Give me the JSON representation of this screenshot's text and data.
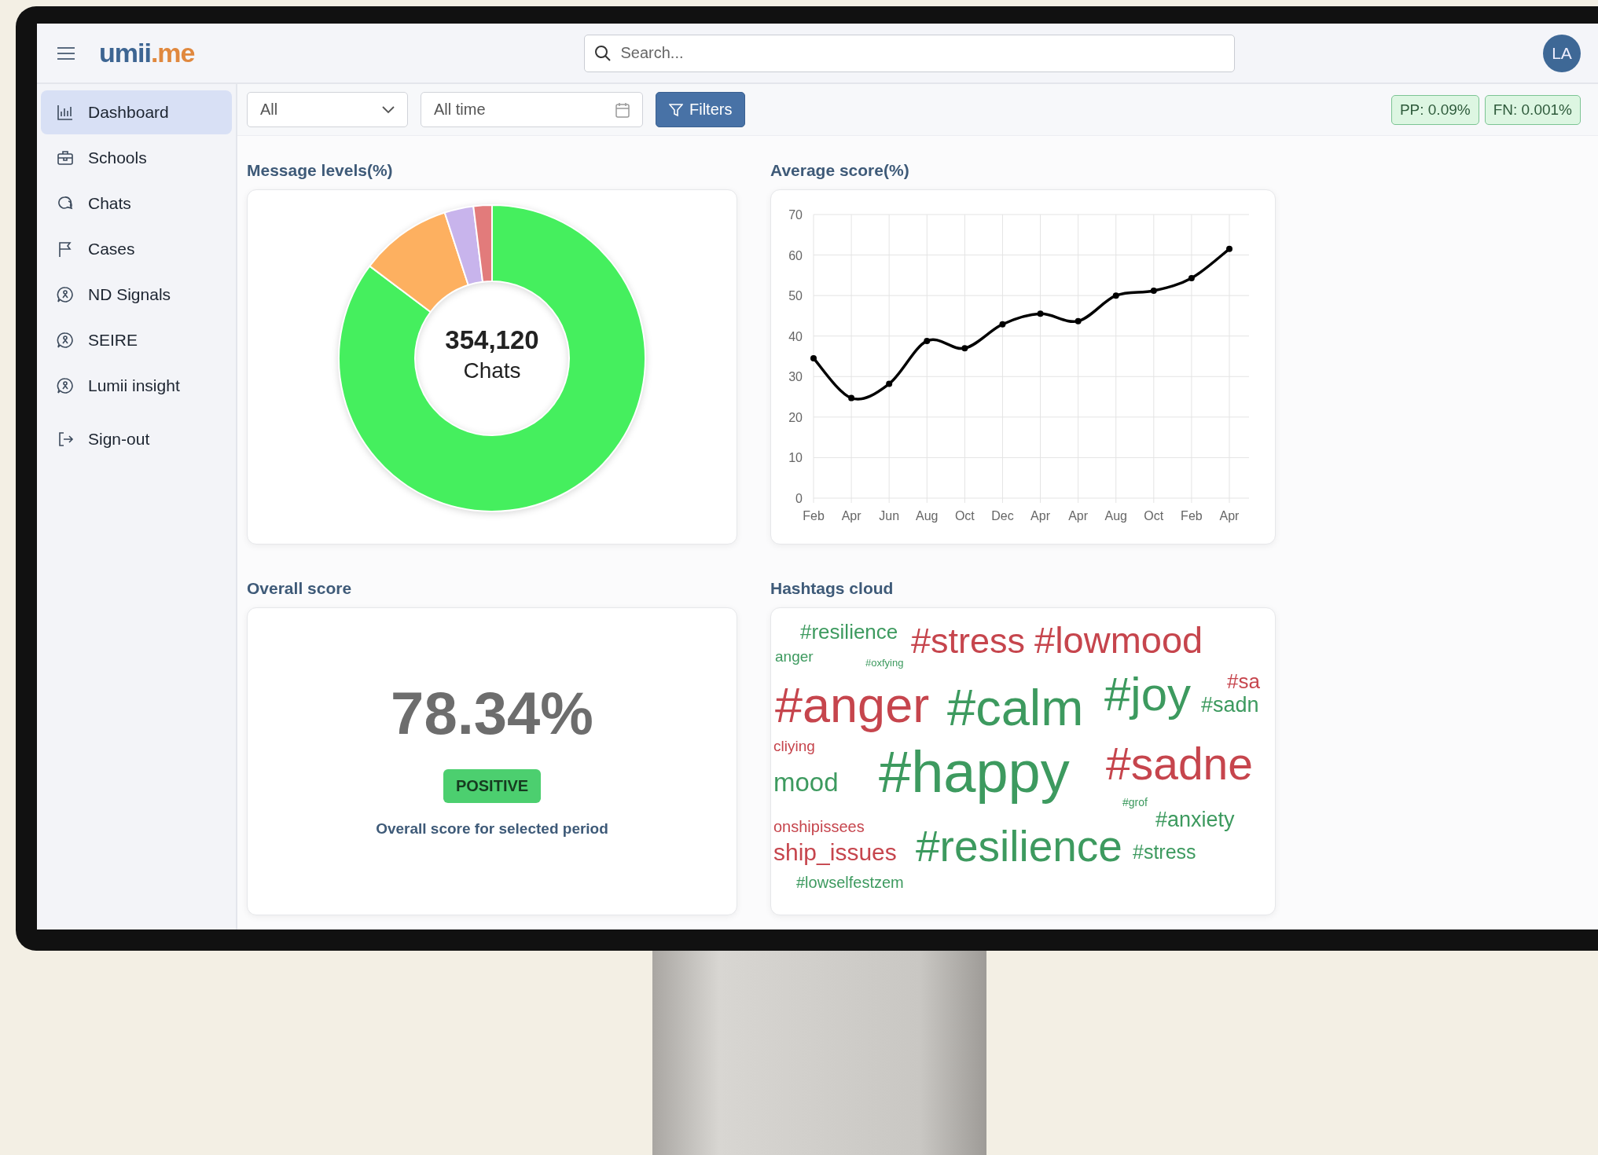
{
  "logo": {
    "text": "umii",
    "accent": ".me"
  },
  "search": {
    "placeholder": "Search..."
  },
  "avatar": {
    "initials": "LA"
  },
  "sidebar": {
    "items": [
      {
        "label": "Dashboard",
        "selected": true
      },
      {
        "label": "Schools",
        "selected": false
      },
      {
        "label": "Chats",
        "selected": false
      },
      {
        "label": "Cases",
        "selected": false
      },
      {
        "label": "ND Signals",
        "selected": false
      },
      {
        "label": "SEIRE",
        "selected": false
      },
      {
        "label": "Lumii insight",
        "selected": false
      },
      {
        "label": "Sign-out",
        "selected": false
      }
    ]
  },
  "filters": {
    "group_select": {
      "value": "All"
    },
    "date_range": {
      "value": "All time"
    },
    "button": "Filters"
  },
  "badges": [
    "PP: 0.09%",
    "FN: 0.001%"
  ],
  "message_levels": {
    "title": "Message levels(%)",
    "total": "354,120",
    "total_label": "Chats"
  },
  "average_score": {
    "title": "Average score(%)",
    "chart_data": {
      "type": "line",
      "categories": [
        "Feb",
        "Apr",
        "Jun",
        "Aug",
        "Oct",
        "Dec",
        "Apr",
        "Apr",
        "Aug",
        "Oct",
        "Feb",
        "Apr"
      ],
      "grid": true,
      "series": [
        {
          "color": "#000000",
          "marker": true,
          "values": [
            34.5,
            24.7,
            28.2,
            38.8,
            37,
            42.9,
            45.5,
            43.7,
            50,
            51.2,
            54.3,
            61.5
          ]
        }
      ],
      "ylim": [
        0,
        70
      ],
      "yticks": [
        0,
        10,
        20,
        30,
        40,
        50,
        60,
        70
      ]
    }
  },
  "overall_score": {
    "title": "Overall score",
    "value": "78.34%",
    "status": "POSITIVE",
    "caption": "Overall score for selected period"
  },
  "hashtags_cloud": {
    "title": "Hashtags cloud",
    "words": [
      {
        "text": "#resilience",
        "color": "#3d9a5f"
      },
      {
        "text": "#stress",
        "color": "#c6454d"
      },
      {
        "text": "#lowmood",
        "color": "#c6454d"
      },
      {
        "text": "anger",
        "color": "#3d9a5f"
      },
      {
        "text": "#oxfying",
        "color": "#3d9a5f"
      },
      {
        "text": "#sa",
        "color": "#c6454d"
      },
      {
        "text": "#anger",
        "color": "#c6454d"
      },
      {
        "text": "#calm",
        "color": "#3d9a5f"
      },
      {
        "text": "#joy",
        "color": "#3d9a5f"
      },
      {
        "text": "#sadn",
        "color": "#3d9a5f"
      },
      {
        "text": "cliying",
        "color": "#c6454d"
      },
      {
        "text": "#happy",
        "color": "#3d9a5f"
      },
      {
        "text": "#sadne",
        "color": "#c6454d"
      },
      {
        "text": "mood",
        "color": "#3d9a5f"
      },
      {
        "text": "#grof",
        "color": "#3d9a5f"
      },
      {
        "text": "#anxiety",
        "color": "#3d9a5f"
      },
      {
        "text": "onshipissees",
        "color": "#c6454d"
      },
      {
        "text": "ship_issues",
        "color": "#c6454d"
      },
      {
        "text": "#resilience",
        "color": "#3d9a5f"
      },
      {
        "text": "#stress",
        "color": "#3d9a5f"
      },
      {
        "text": "#lowselfestzem",
        "color": "#3d9a5f"
      }
    ]
  }
}
